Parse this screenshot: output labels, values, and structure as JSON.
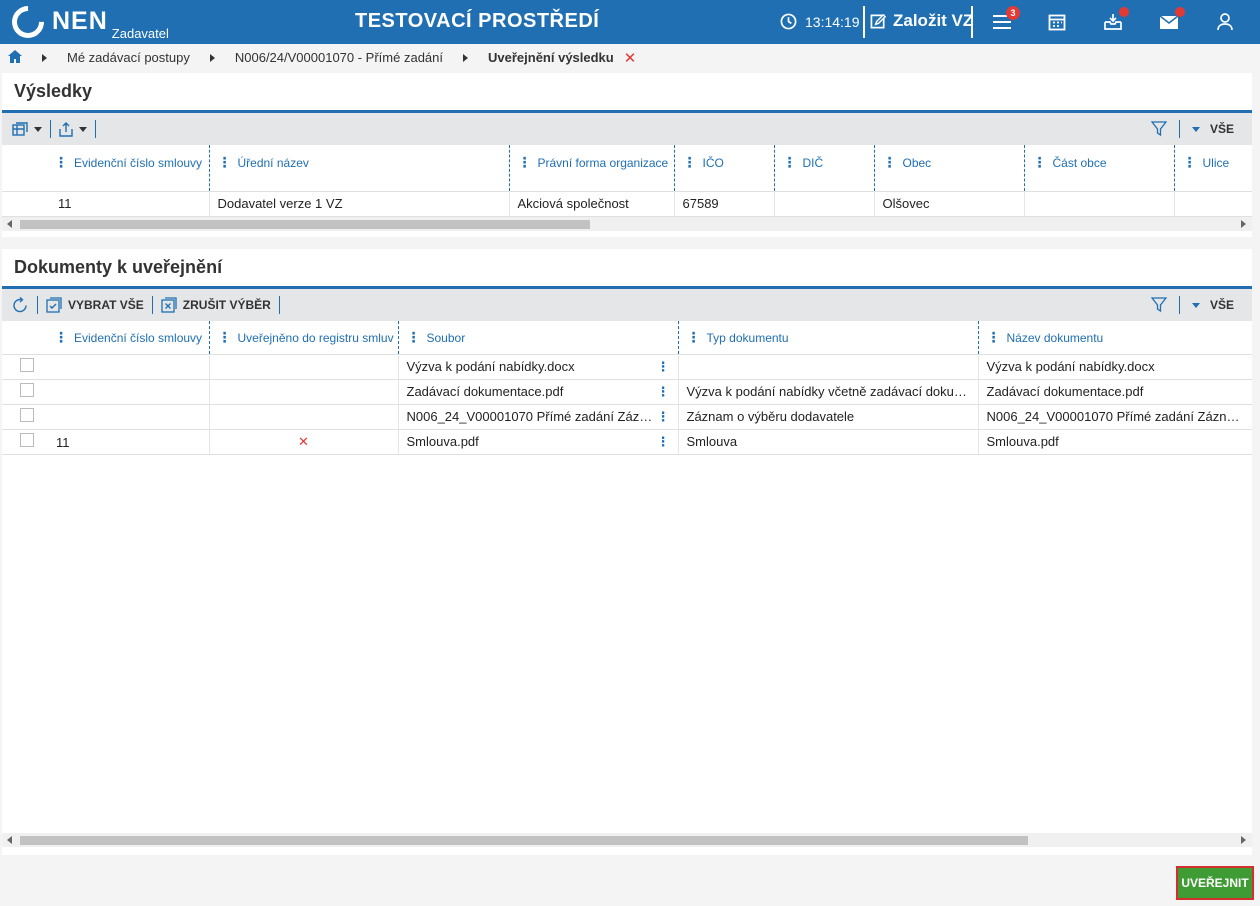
{
  "header": {
    "logo_text": "NEN",
    "logo_sub": "Zadavatel",
    "environment": "TESTOVACÍ PROSTŘEDÍ",
    "time": "13:14:19",
    "new_vz_label": "Založit VZ",
    "menu_badge": "3"
  },
  "breadcrumb": {
    "items": [
      "Mé zadávací postupy",
      "N006/24/V00001070 - Přímé zadání"
    ],
    "current": "Uveřejnění výsledku"
  },
  "results": {
    "title": "Výsledky",
    "filter_all": "VŠE",
    "columns": [
      "Evidenční číslo smlouvy",
      "Úřední název",
      "Právní forma organizace",
      "IČO",
      "DIČ",
      "Obec",
      "Část obce",
      "Ulice"
    ],
    "rows": [
      [
        "11",
        "Dodavatel verze 1 VZ",
        "Akciová společnost",
        "67589",
        "",
        "Olšovec",
        "",
        ""
      ]
    ]
  },
  "documents": {
    "title": "Dokumenty k uveřejnění",
    "select_all": "VYBRAT VŠE",
    "deselect": "ZRUŠIT VÝBĚR",
    "filter_all": "VŠE",
    "columns": [
      "Evidenční číslo smlouvy",
      "Uveřejněno do registru smluv",
      "Soubor",
      "Typ dokumentu",
      "Název dokumentu"
    ],
    "rows": [
      {
        "contract": "",
        "registered": "",
        "file": "Výzva k podání nabídky.docx",
        "type": "",
        "name": "Výzva k podání nabídky.docx"
      },
      {
        "contract": "",
        "registered": "",
        "file": "Zadávací dokumentace.pdf",
        "type": "Výzva k podání nabídky včetně zadávací dokum…",
        "name": "Zadávací dokumentace.pdf"
      },
      {
        "contract": "",
        "registered": "",
        "file": "N006_24_V00001070 Přímé zadání Záz…",
        "type": "Záznam o výběru dodavatele",
        "name": "N006_24_V00001070 Přímé zadání Záznam…"
      },
      {
        "contract": "11",
        "registered": "✕",
        "file": "Smlouva.pdf",
        "type": "Smlouva",
        "name": "Smlouva.pdf"
      }
    ]
  },
  "actions": {
    "publish_label": "UVEŘEJNIT"
  },
  "colors": {
    "primary": "#1f6fb2",
    "publish_bg": "#3f9c35",
    "alert": "#e53935"
  }
}
